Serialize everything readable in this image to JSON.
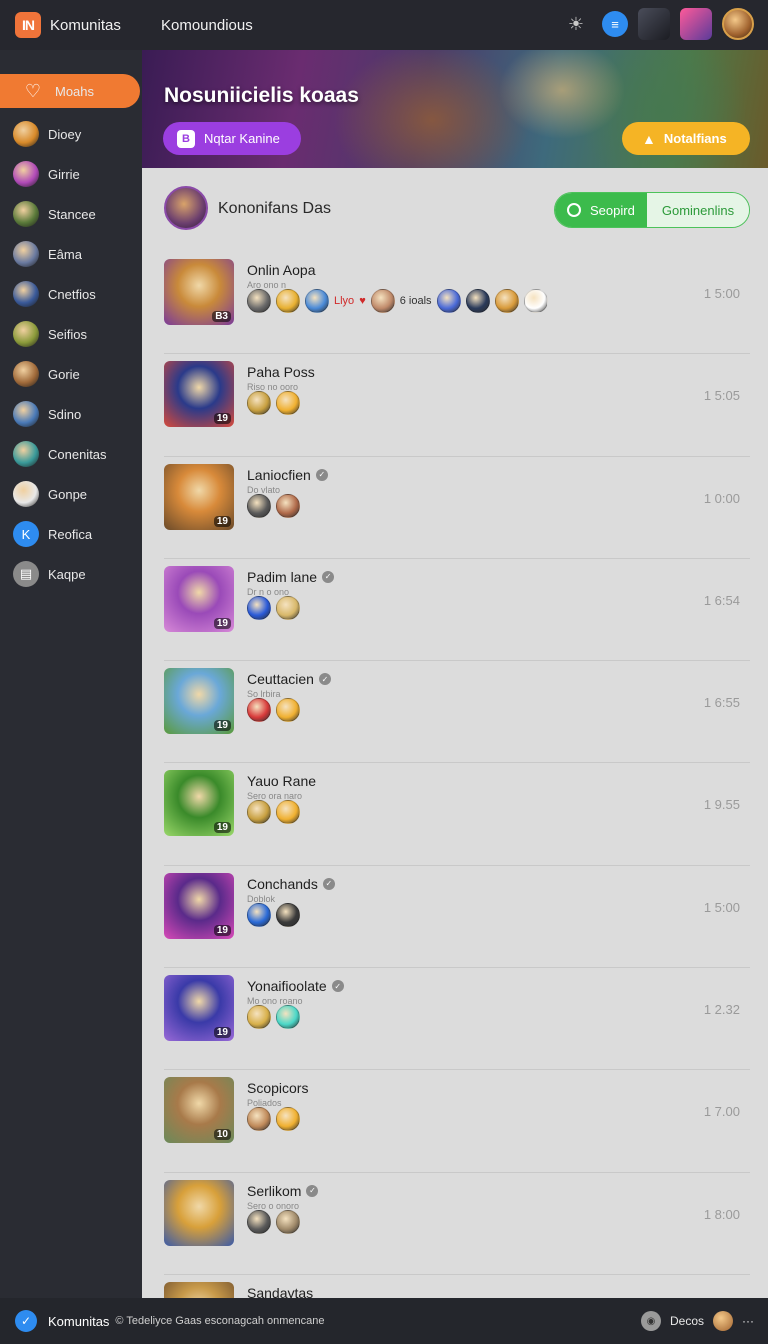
{
  "topbar": {
    "logo_text": "IN",
    "app_name": "Komunitas",
    "title": "Komoundious"
  },
  "sidebar": {
    "items": [
      {
        "label": "Moahs",
        "icon": "heart-icon",
        "color": "#f07a32",
        "active": true
      },
      {
        "label": "Dioey",
        "icon": "star-icon",
        "color": "#d88a2a"
      },
      {
        "label": "Girrie",
        "icon": "crystal-icon",
        "color": "#b04ab8"
      },
      {
        "label": "Stancee",
        "icon": "tree-icon",
        "color": "#5a7a3a"
      },
      {
        "label": "Eâma",
        "icon": "character-icon",
        "color": "#6a7aa0"
      },
      {
        "label": "Cnetfios",
        "icon": "character-icon",
        "color": "#3a5a9a"
      },
      {
        "label": "Seifios",
        "icon": "character-icon",
        "color": "#8a9a3a"
      },
      {
        "label": "Gorie",
        "icon": "character-icon",
        "color": "#a06a3a"
      },
      {
        "label": "Sdino",
        "icon": "character-icon",
        "color": "#4a7ab8"
      },
      {
        "label": "Conenitas",
        "icon": "character-icon",
        "color": "#3a9a9a"
      },
      {
        "label": "Gonpe",
        "icon": "character-icon",
        "color": "#e8e8e8"
      },
      {
        "label": "Reofica",
        "icon": "k-icon",
        "color": "#2e8cf0"
      },
      {
        "label": "Kaqpe",
        "icon": "document-icon",
        "color": "#8a8a8a"
      }
    ]
  },
  "banner": {
    "title": "Nosuniicielis koaas",
    "left_button": "Nqtar Kanine",
    "right_button": "Notalfians"
  },
  "main": {
    "header_title": "Kononifans Das",
    "toggle_on": "Seopird",
    "toggle_off": "Gominenlins"
  },
  "rows": [
    {
      "name": "Onlin Aopa",
      "sub": "Aro ono n",
      "time": "1 5:00",
      "verified": false,
      "level": "B3",
      "thumb": [
        "#c98a3a",
        "#7a3a9a"
      ],
      "chips": [
        "#6a6a6a",
        "#e8b030",
        "#4a8ad8"
      ],
      "chip_label": "Llyo",
      "chips2": [
        "#c08a6a"
      ],
      "chip_label2": "6 ioals",
      "chips3": [
        "#4a6ad8",
        "#2a3a5a",
        "#d89a3a",
        "#ffffff"
      ]
    },
    {
      "name": "Paha Poss",
      "sub": "Riso no ooro",
      "time": "1 5:05",
      "verified": false,
      "level": "19",
      "thumb": [
        "#2a3a8a",
        "#d84a3a"
      ],
      "chips": [
        "#c8a040",
        "#f0b030"
      ]
    },
    {
      "name": "Laniocfien",
      "sub": "Do vlato",
      "time": "1 0:00",
      "verified": true,
      "level": "19",
      "thumb": [
        "#d88a3a",
        "#6a4a2a"
      ],
      "chips": [
        "#5a5a5a",
        "#b06a4a"
      ]
    },
    {
      "name": "Padim lane",
      "sub": "Dr n o ono",
      "time": "1 6:54",
      "verified": true,
      "level": "19",
      "thumb": [
        "#9a4ab8",
        "#d88ad8"
      ],
      "chips": [
        "#2a5ad8",
        "#d8b86a"
      ]
    },
    {
      "name": "Ceuttacien",
      "sub": "So lrbira",
      "time": "1 6:55",
      "verified": true,
      "level": "19",
      "thumb": [
        "#6aa8d8",
        "#5a9a3a"
      ],
      "chips": [
        "#d83a3a",
        "#f0b030"
      ]
    },
    {
      "name": "Yauo Rane",
      "sub": "Sero ora naro",
      "time": "1 9.55",
      "verified": false,
      "level": "19",
      "thumb": [
        "#3a8a2a",
        "#9ad86a"
      ],
      "chips": [
        "#c8a040",
        "#f0b030"
      ]
    },
    {
      "name": "Conchands",
      "sub": "Doblok",
      "time": "1 5:00",
      "verified": true,
      "level": "19",
      "thumb": [
        "#5a2a8a",
        "#d84ab8"
      ],
      "chips": [
        "#2a6ad8",
        "#3a3a3a"
      ]
    },
    {
      "name": "Yonaifioolate",
      "sub": "Mo ono roano",
      "time": "1 2.32",
      "verified": true,
      "level": "19",
      "thumb": [
        "#3a3aa8",
        "#9a6ad8"
      ],
      "chips": [
        "#d8b04a",
        "#4ad8c8"
      ]
    },
    {
      "name": "Scopicors",
      "sub": "Poliados",
      "time": "1 7.00",
      "verified": false,
      "level": "10",
      "thumb": [
        "#a87a4a",
        "#6a8a5a"
      ],
      "chips": [
        "#c08a5a",
        "#f0b030"
      ]
    },
    {
      "name": "Serlikom",
      "sub": "Sero o onoro",
      "time": "1 8:00",
      "verified": true,
      "level": "",
      "thumb": [
        "#d8a03a",
        "#3a5aa8"
      ],
      "chips": [
        "#5a5a5a",
        "#a08a6a"
      ]
    },
    {
      "name": "Sandaytas",
      "sub": "",
      "time": "",
      "verified": false,
      "level": "",
      "thumb": [
        "#c89a4a",
        "#6a4a2a"
      ],
      "chips": []
    }
  ],
  "bottombar": {
    "name": "Komunitas",
    "status": "© Tedeliyce Gaas esconagcah onmencane",
    "right_label": "Decos",
    "more": "···"
  }
}
